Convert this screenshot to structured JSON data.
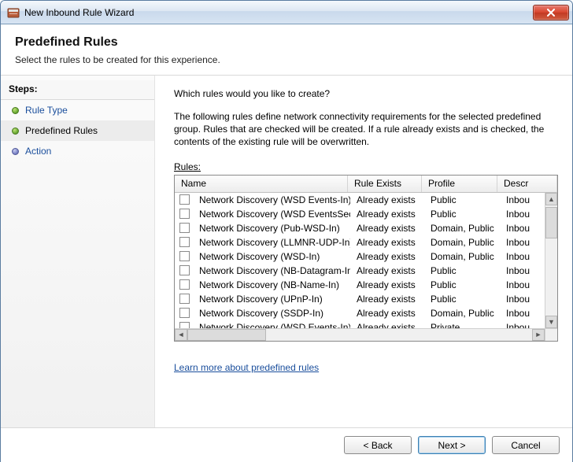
{
  "window": {
    "title": "New Inbound Rule Wizard"
  },
  "header": {
    "title": "Predefined Rules",
    "subtitle": "Select the rules to be created for this experience."
  },
  "steps": {
    "heading": "Steps:",
    "items": [
      {
        "label": "Rule Type",
        "state": "done"
      },
      {
        "label": "Predefined Rules",
        "state": "current"
      },
      {
        "label": "Action",
        "state": "future"
      }
    ]
  },
  "content": {
    "question": "Which rules would you like to create?",
    "description": "The following rules define network connectivity requirements for the selected predefined group. Rules that are checked will be created. If a rule already exists and is checked, the contents of the existing rule will be overwritten.",
    "rules_label": "Rules:",
    "learn_link": "Learn more about predefined rules"
  },
  "table": {
    "columns": {
      "name": "Name",
      "exists": "Rule Exists",
      "profile": "Profile",
      "desc": "Descr"
    },
    "rows": [
      {
        "name": "Network Discovery (WSD Events-In)",
        "exists": "Already exists",
        "profile": "Public",
        "desc": "Inbou"
      },
      {
        "name": "Network Discovery (WSD EventsSecure-In)",
        "exists": "Already exists",
        "profile": "Public",
        "desc": "Inbou"
      },
      {
        "name": "Network Discovery (Pub-WSD-In)",
        "exists": "Already exists",
        "profile": "Domain, Public",
        "desc": "Inbou"
      },
      {
        "name": "Network Discovery (LLMNR-UDP-In)",
        "exists": "Already exists",
        "profile": "Domain, Public",
        "desc": "Inbou"
      },
      {
        "name": "Network Discovery (WSD-In)",
        "exists": "Already exists",
        "profile": "Domain, Public",
        "desc": "Inbou"
      },
      {
        "name": "Network Discovery (NB-Datagram-In)",
        "exists": "Already exists",
        "profile": "Public",
        "desc": "Inbou"
      },
      {
        "name": "Network Discovery (NB-Name-In)",
        "exists": "Already exists",
        "profile": "Public",
        "desc": "Inbou"
      },
      {
        "name": "Network Discovery (UPnP-In)",
        "exists": "Already exists",
        "profile": "Public",
        "desc": "Inbou"
      },
      {
        "name": "Network Discovery (SSDP-In)",
        "exists": "Already exists",
        "profile": "Domain, Public",
        "desc": "Inbou"
      },
      {
        "name": "Network Discovery (WSD Events-In)",
        "exists": "Already exists",
        "profile": "Private",
        "desc": "Inbou"
      }
    ]
  },
  "footer": {
    "back": "< Back",
    "next": "Next >",
    "cancel": "Cancel"
  }
}
